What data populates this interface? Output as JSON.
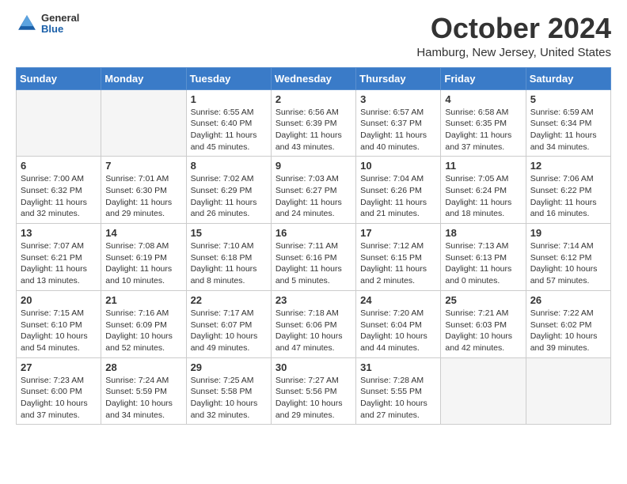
{
  "header": {
    "logo": {
      "general": "General",
      "blue": "Blue"
    },
    "title": "October 2024",
    "location": "Hamburg, New Jersey, United States"
  },
  "days_of_week": [
    "Sunday",
    "Monday",
    "Tuesday",
    "Wednesday",
    "Thursday",
    "Friday",
    "Saturday"
  ],
  "weeks": [
    [
      {
        "day": "",
        "info": ""
      },
      {
        "day": "",
        "info": ""
      },
      {
        "day": "1",
        "info": "Sunrise: 6:55 AM\nSunset: 6:40 PM\nDaylight: 11 hours and 45 minutes."
      },
      {
        "day": "2",
        "info": "Sunrise: 6:56 AM\nSunset: 6:39 PM\nDaylight: 11 hours and 43 minutes."
      },
      {
        "day": "3",
        "info": "Sunrise: 6:57 AM\nSunset: 6:37 PM\nDaylight: 11 hours and 40 minutes."
      },
      {
        "day": "4",
        "info": "Sunrise: 6:58 AM\nSunset: 6:35 PM\nDaylight: 11 hours and 37 minutes."
      },
      {
        "day": "5",
        "info": "Sunrise: 6:59 AM\nSunset: 6:34 PM\nDaylight: 11 hours and 34 minutes."
      }
    ],
    [
      {
        "day": "6",
        "info": "Sunrise: 7:00 AM\nSunset: 6:32 PM\nDaylight: 11 hours and 32 minutes."
      },
      {
        "day": "7",
        "info": "Sunrise: 7:01 AM\nSunset: 6:30 PM\nDaylight: 11 hours and 29 minutes."
      },
      {
        "day": "8",
        "info": "Sunrise: 7:02 AM\nSunset: 6:29 PM\nDaylight: 11 hours and 26 minutes."
      },
      {
        "day": "9",
        "info": "Sunrise: 7:03 AM\nSunset: 6:27 PM\nDaylight: 11 hours and 24 minutes."
      },
      {
        "day": "10",
        "info": "Sunrise: 7:04 AM\nSunset: 6:26 PM\nDaylight: 11 hours and 21 minutes."
      },
      {
        "day": "11",
        "info": "Sunrise: 7:05 AM\nSunset: 6:24 PM\nDaylight: 11 hours and 18 minutes."
      },
      {
        "day": "12",
        "info": "Sunrise: 7:06 AM\nSunset: 6:22 PM\nDaylight: 11 hours and 16 minutes."
      }
    ],
    [
      {
        "day": "13",
        "info": "Sunrise: 7:07 AM\nSunset: 6:21 PM\nDaylight: 11 hours and 13 minutes."
      },
      {
        "day": "14",
        "info": "Sunrise: 7:08 AM\nSunset: 6:19 PM\nDaylight: 11 hours and 10 minutes."
      },
      {
        "day": "15",
        "info": "Sunrise: 7:10 AM\nSunset: 6:18 PM\nDaylight: 11 hours and 8 minutes."
      },
      {
        "day": "16",
        "info": "Sunrise: 7:11 AM\nSunset: 6:16 PM\nDaylight: 11 hours and 5 minutes."
      },
      {
        "day": "17",
        "info": "Sunrise: 7:12 AM\nSunset: 6:15 PM\nDaylight: 11 hours and 2 minutes."
      },
      {
        "day": "18",
        "info": "Sunrise: 7:13 AM\nSunset: 6:13 PM\nDaylight: 11 hours and 0 minutes."
      },
      {
        "day": "19",
        "info": "Sunrise: 7:14 AM\nSunset: 6:12 PM\nDaylight: 10 hours and 57 minutes."
      }
    ],
    [
      {
        "day": "20",
        "info": "Sunrise: 7:15 AM\nSunset: 6:10 PM\nDaylight: 10 hours and 54 minutes."
      },
      {
        "day": "21",
        "info": "Sunrise: 7:16 AM\nSunset: 6:09 PM\nDaylight: 10 hours and 52 minutes."
      },
      {
        "day": "22",
        "info": "Sunrise: 7:17 AM\nSunset: 6:07 PM\nDaylight: 10 hours and 49 minutes."
      },
      {
        "day": "23",
        "info": "Sunrise: 7:18 AM\nSunset: 6:06 PM\nDaylight: 10 hours and 47 minutes."
      },
      {
        "day": "24",
        "info": "Sunrise: 7:20 AM\nSunset: 6:04 PM\nDaylight: 10 hours and 44 minutes."
      },
      {
        "day": "25",
        "info": "Sunrise: 7:21 AM\nSunset: 6:03 PM\nDaylight: 10 hours and 42 minutes."
      },
      {
        "day": "26",
        "info": "Sunrise: 7:22 AM\nSunset: 6:02 PM\nDaylight: 10 hours and 39 minutes."
      }
    ],
    [
      {
        "day": "27",
        "info": "Sunrise: 7:23 AM\nSunset: 6:00 PM\nDaylight: 10 hours and 37 minutes."
      },
      {
        "day": "28",
        "info": "Sunrise: 7:24 AM\nSunset: 5:59 PM\nDaylight: 10 hours and 34 minutes."
      },
      {
        "day": "29",
        "info": "Sunrise: 7:25 AM\nSunset: 5:58 PM\nDaylight: 10 hours and 32 minutes."
      },
      {
        "day": "30",
        "info": "Sunrise: 7:27 AM\nSunset: 5:56 PM\nDaylight: 10 hours and 29 minutes."
      },
      {
        "day": "31",
        "info": "Sunrise: 7:28 AM\nSunset: 5:55 PM\nDaylight: 10 hours and 27 minutes."
      },
      {
        "day": "",
        "info": ""
      },
      {
        "day": "",
        "info": ""
      }
    ]
  ]
}
